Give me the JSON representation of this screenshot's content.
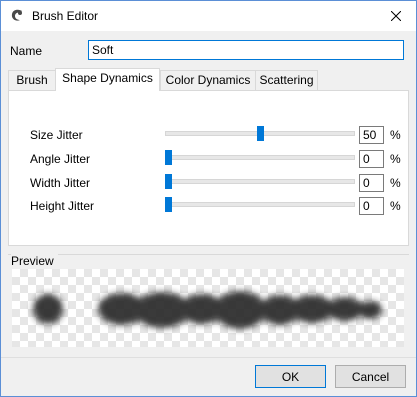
{
  "window": {
    "title": "Brush Editor",
    "close_icon": "close-icon",
    "app_icon": "brush-app-icon"
  },
  "name": {
    "label": "Name",
    "value": "Soft"
  },
  "tabs": [
    {
      "label": "Brush",
      "active": false
    },
    {
      "label": "Shape Dynamics",
      "active": true
    },
    {
      "label": "Color Dynamics",
      "active": false
    },
    {
      "label": "Scattering",
      "active": false
    }
  ],
  "shape_dynamics": {
    "rows": [
      {
        "label": "Size Jitter",
        "value": "50",
        "unit": "%",
        "fraction": 0.5
      },
      {
        "label": "Angle Jitter",
        "value": "0",
        "unit": "%",
        "fraction": 0
      },
      {
        "label": "Width Jitter",
        "value": "0",
        "unit": "%",
        "fraction": 0
      },
      {
        "label": "Height Jitter",
        "value": "0",
        "unit": "%",
        "fraction": 0
      }
    ]
  },
  "preview": {
    "label": "Preview"
  },
  "buttons": {
    "ok": "OK",
    "cancel": "Cancel"
  },
  "colors": {
    "accent": "#0078d7",
    "stroke": "#2a2a2a"
  }
}
